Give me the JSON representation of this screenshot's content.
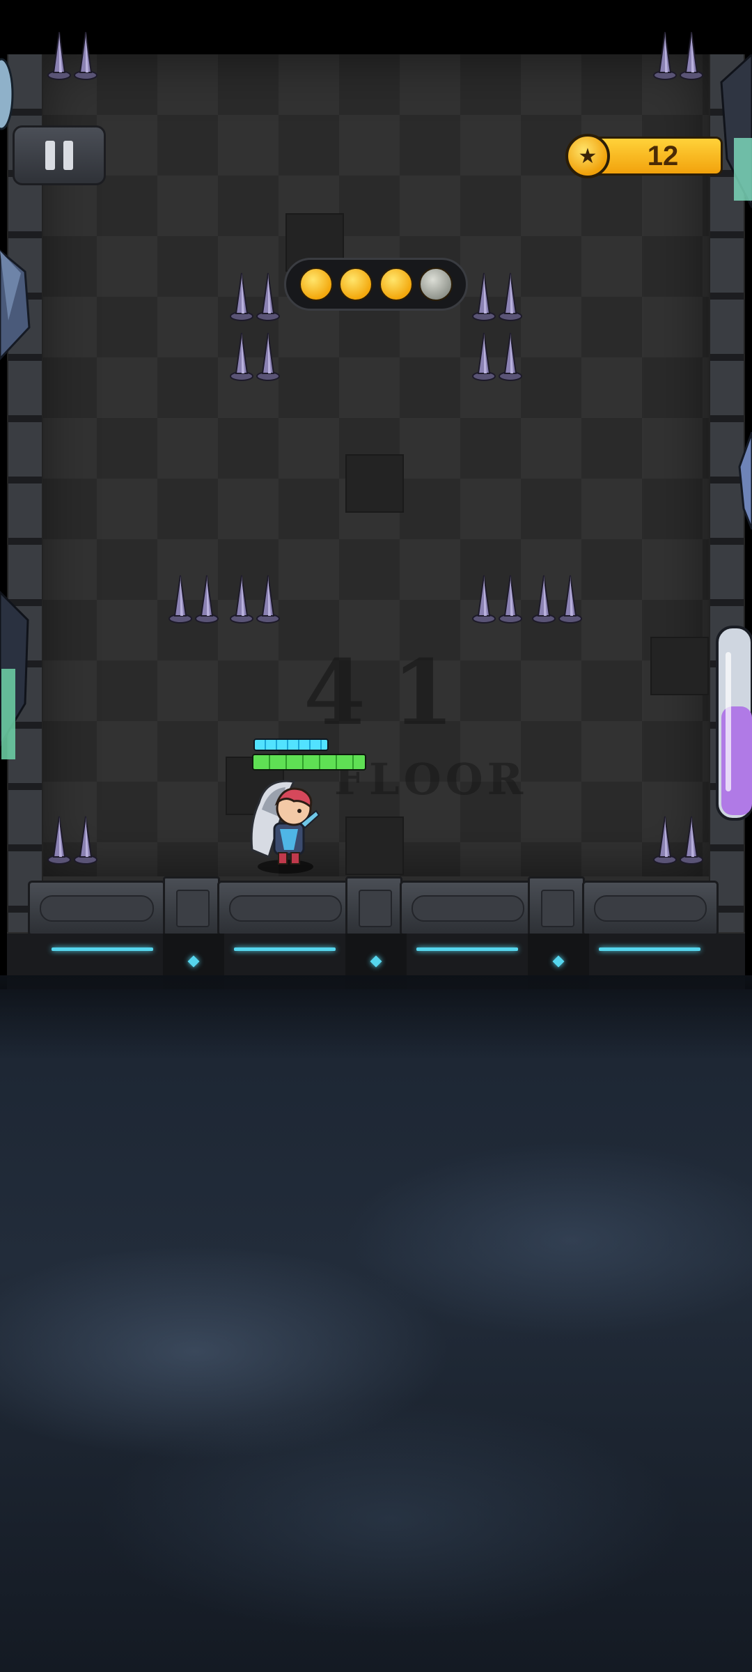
{
  "hud": {
    "coins": "12",
    "coin_icon": "star-coin-icon",
    "pause_icon": "pause-icon"
  },
  "stage_progress": {
    "collected": 3,
    "total": 4
  },
  "floor_marking": {
    "number": "41",
    "label": "FLOOR"
  },
  "hero": {
    "shield_fraction": 1.0,
    "health_fraction": 1.0
  },
  "colors": {
    "accent_gold": "#f2a20c",
    "shield_cyan": "#52e2ff",
    "health_green": "#5fe054",
    "glow_cyan": "#56d6ee"
  }
}
